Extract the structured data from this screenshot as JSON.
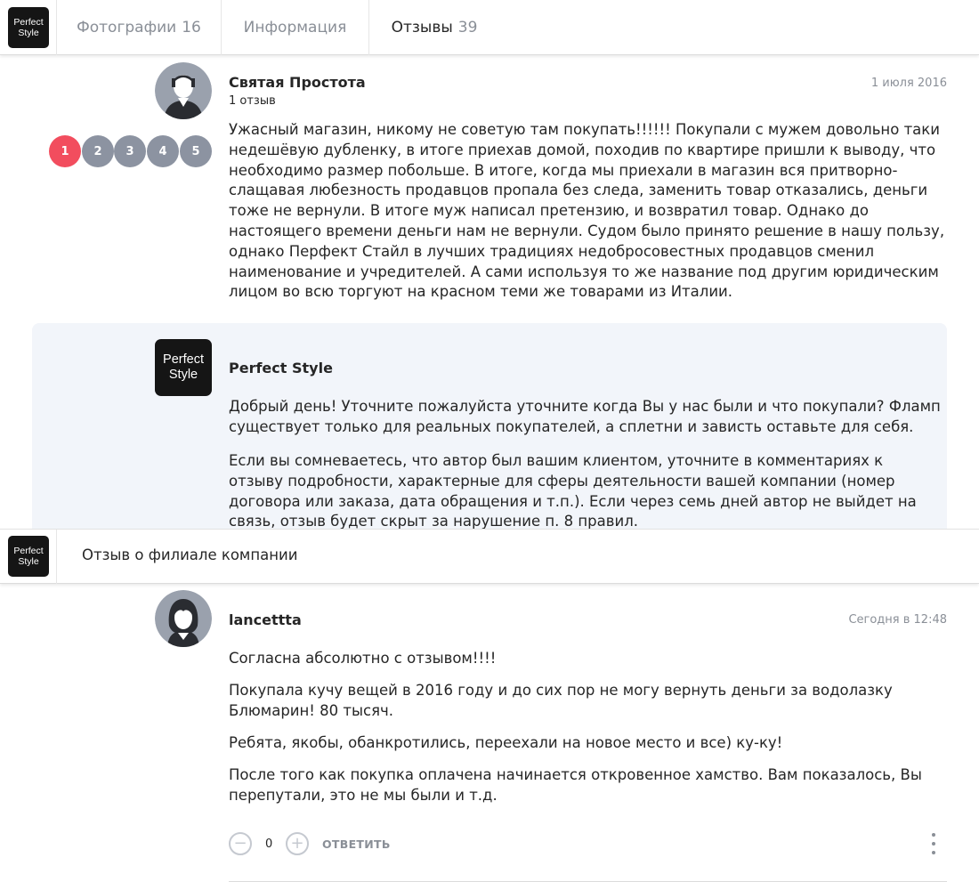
{
  "brand": {
    "logo_line1": "Perfect",
    "logo_line2": "Style"
  },
  "tabs": [
    {
      "label": "Фотографии",
      "count": "16"
    },
    {
      "label": "Информация",
      "count": ""
    },
    {
      "label": "Отзывы",
      "count": "39"
    }
  ],
  "review1": {
    "author": "Святая Простота",
    "reviews_count": "1 отзыв",
    "date": "1 июля 2016",
    "rating": {
      "options": [
        "1",
        "2",
        "3",
        "4",
        "5"
      ],
      "selected": 1
    },
    "text": "Ужасный магазин, никому не советую там покупать!!!!!! Покупали с мужем довольно таки недешёвую дубленку, в итоге приехав домой, походив по квартире пришли к выводу, что необходимо размер побольше. В итоге, когда мы приехали в магазин вся притворно-слащавая любезность продавцов пропала без следа, заменить товар отказались, деньги тоже не вернули. В итоге муж написал претензию, и возвратил товар. Однако до настоящего времени деньги нам не вернули. Судом было принято решение в нашу пользу, однако Перфект Стайл в лучших традициях недобросовестных продавцов сменил наименование и учредителей. А сами используя то же название под другим юридическим лицом во всю торгуют на красном теми же товарами из Италии."
  },
  "reply1": {
    "author": "Perfect Style",
    "logo_line1": "Perfect",
    "logo_line2": "Style",
    "para1": "Добрый день! Уточните пожалуйста уточните когда Вы у нас были и что покупали? Фламп существует только для реальных покупателей, а сплетни и зависть оставьте для себя.",
    "para2": "Если вы сомневаетесь, что автор был вашим клиентом, уточните в комментариях к отзыву подробности, характерные для сферы деятельности вашей компании (номер договора или заказа, дата обращения и т.п.). Если через семь дней автор не выйдет на связь, отзыв будет скрыт за нарушение п. 8 правил."
  },
  "subbar": {
    "title": "Отзыв о филиале компании"
  },
  "review2": {
    "author": "lancettta",
    "date": "Сегодня в 12:48",
    "paragraphs": [
      "Согласна абсолютно с отзывом!!!!",
      "Покупала кучу вещей в 2016 году и до сих пор не могу вернуть деньги за водолазку Блюмарин! 80 тысяч.",
      "Ребята, якобы, обанкротились, переехали на новое место и все) ку-ку!",
      "После того как покупка оплачена начинается откровенное хамство. Вам показалось, Вы перепутали, это не мы были и т.д."
    ],
    "votes": "0",
    "minus_icon": "−",
    "plus_icon": "+",
    "reply_label": "ОТВЕТИТЬ"
  },
  "colors": {
    "rating_active": "#f24d5e",
    "rating_inactive": "#8c93a1",
    "reply_background": "#f2f5fa",
    "muted_text": "#8a8f97"
  }
}
